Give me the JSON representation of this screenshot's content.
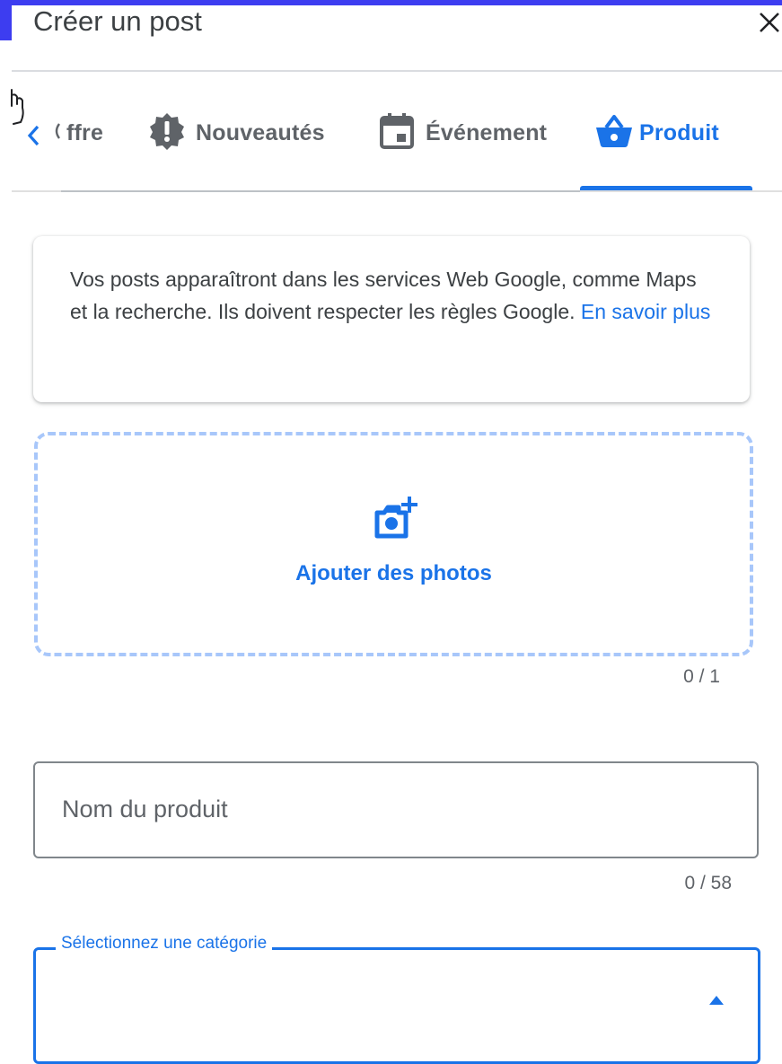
{
  "header": {
    "title": "Créer un post"
  },
  "tabs": {
    "items": [
      {
        "label": "Offre",
        "visible_label": "ffre",
        "icon": "offer-icon"
      },
      {
        "label": "Nouveautés",
        "icon": "alert-badge-icon"
      },
      {
        "label": "Événement",
        "icon": "calendar-icon"
      },
      {
        "label": "Produit",
        "icon": "shopping-basket-icon",
        "active": true
      }
    ]
  },
  "info": {
    "text": "Vos posts apparaîtront dans les services Web Google, comme Maps et la recherche. Ils doivent respecter les règles Google.",
    "link": "En savoir plus"
  },
  "photos": {
    "label": "Ajouter des photos",
    "counter": "0 / 1"
  },
  "product_name": {
    "placeholder": "Nom du produit",
    "counter": "0 / 58"
  },
  "category": {
    "label": "Sélectionnez une catégorie",
    "value": ""
  },
  "colors": {
    "accent": "#1a73e8",
    "frame": "#3d3df0",
    "dashed_border": "#a8c7fa"
  }
}
